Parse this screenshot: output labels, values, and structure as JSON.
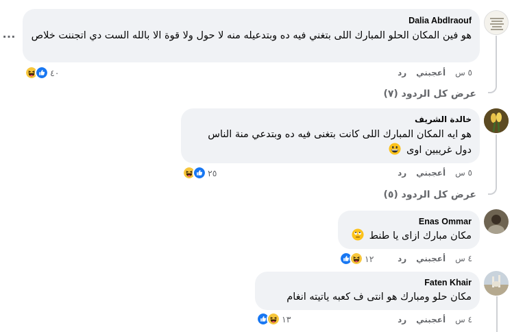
{
  "comments": [
    {
      "author": "Dalia Abdlraouf",
      "text": "هو فين المكان الحلو المبارك اللى بتغني فيه ده وبتدعيله منه لا حول ولا قوة الا بالله الست دي اتجننت خلاص",
      "time": "٥ س",
      "like_label": "أعجبني",
      "reply_label": "رد",
      "reaction_count": "٤٠",
      "reaction_icons": [
        "haha",
        "like"
      ],
      "view_replies": "عرض كل الردود (٧)"
    },
    {
      "author": "خالدة الشريف",
      "text": "هو ايه المكان المبارك اللى كانت بتغنى فيه ده وبتدعي منة الناس دول غريبين اوى",
      "emoji": "grinning-face",
      "time": "٥ س",
      "like_label": "أعجبني",
      "reply_label": "رد",
      "reaction_count": "٢٥",
      "reaction_icons": [
        "haha",
        "like"
      ],
      "view_replies": "عرض كل الردود (٥)"
    },
    {
      "author": "Enas Ommar",
      "text": "مكان مبارك ازاى يا طنط",
      "emoji": "rolling-eyes-face",
      "time": "٤ س",
      "like_label": "أعجبني",
      "reply_label": "رد",
      "reaction_count": "١٢",
      "reaction_icons": [
        "like",
        "haha"
      ]
    },
    {
      "author": "Faten Khair",
      "text": "مكان حلو ومبارك هو انتى ف كعبه ياتيته انغام",
      "time": "٤ س",
      "like_label": "أعجبني",
      "reply_label": "رد",
      "reaction_count": "١٣",
      "reaction_icons": [
        "like",
        "haha"
      ]
    }
  ],
  "more_options_glyph": "…",
  "colors": {
    "bubble": "#f0f2f5",
    "meta_text": "#65676b",
    "like_blue": "#1877f2",
    "haha_yellow": "#f7c63b",
    "thread_line": "#ced0d4"
  }
}
